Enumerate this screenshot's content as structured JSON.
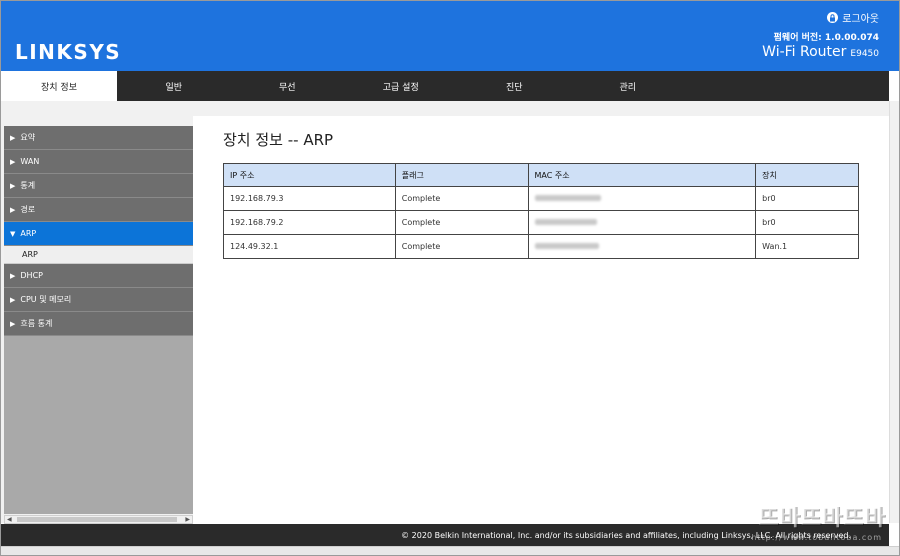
{
  "header": {
    "brand": "LINKSYS",
    "logout_label": "로그아웃",
    "firmware": "펌웨어 버전: 1.0.00.074",
    "model_name": "Wi-Fi Router",
    "model_sku": "E9450"
  },
  "nav": {
    "tabs": [
      {
        "label": "장치 정보",
        "active": true
      },
      {
        "label": "일반"
      },
      {
        "label": "무선"
      },
      {
        "label": "고급 설정"
      },
      {
        "label": "진단"
      },
      {
        "label": "관리"
      }
    ]
  },
  "sidebar": {
    "items": [
      {
        "label": "요약"
      },
      {
        "label": "WAN"
      },
      {
        "label": "통계"
      },
      {
        "label": "경로"
      },
      {
        "label": "ARP",
        "active": true,
        "sub": "ARP"
      },
      {
        "label": "DHCP"
      },
      {
        "label": "CPU 및 메모리"
      },
      {
        "label": "흐름 통계"
      }
    ]
  },
  "main": {
    "title": "장치 정보 -- ARP",
    "table": {
      "headers": [
        "IP 주소",
        "플래그",
        "MAC 주소",
        "장치"
      ],
      "rows": [
        {
          "ip": "192.168.79.3",
          "flag": "Complete",
          "device": "br0"
        },
        {
          "ip": "192.168.79.2",
          "flag": "Complete",
          "device": "br0"
        },
        {
          "ip": "124.49.32.1",
          "flag": "Complete",
          "device": "Wan.1"
        }
      ]
    }
  },
  "footer": {
    "copyright": "© 2020 Belkin International, Inc. and/or its subsidiaries and affiliates, including Linksys, LLC. All rights reserved."
  },
  "watermark": {
    "text": "뜨바뜨바뜨바",
    "url": "http://www.tobahtoba.com"
  }
}
